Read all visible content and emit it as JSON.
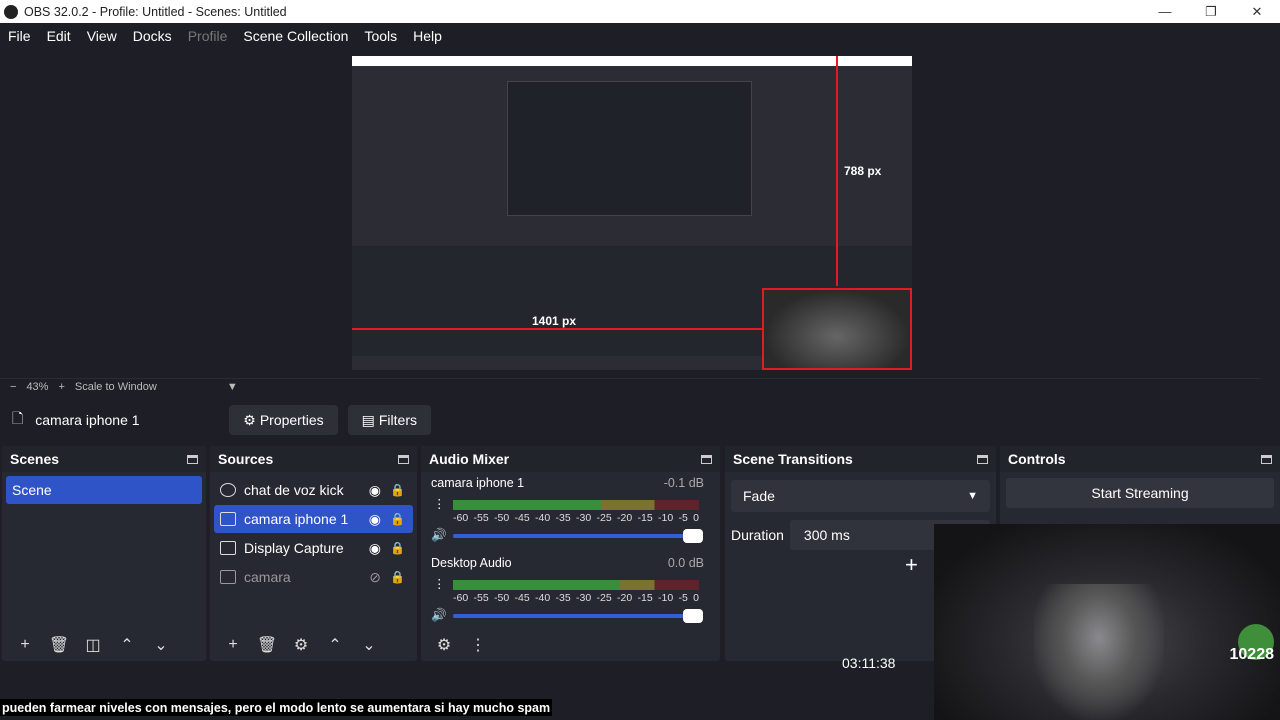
{
  "window": {
    "title": "OBS 32.0.2 - Profile: Untitled - Scenes: Untitled",
    "controls": [
      "—",
      "❐",
      "✕"
    ]
  },
  "menu": [
    "File",
    "Edit",
    "View",
    "Docks",
    "Profile",
    "Scene Collection",
    "Tools",
    "Help"
  ],
  "preview": {
    "label_width": "1401 px",
    "label_height": "788 px"
  },
  "zoombar": {
    "minus": "−",
    "zoom": "43%",
    "plus": "+",
    "scale": "Scale to Window"
  },
  "context": {
    "source": "camara iphone 1",
    "properties_label": "Properties",
    "filters_label": "Filters"
  },
  "scenes": {
    "title": "Scenes",
    "items": [
      "Scene"
    ]
  },
  "sources": {
    "title": "Sources",
    "items": [
      {
        "name": "chat de voz kick",
        "visible": true
      },
      {
        "name": "camara iphone 1",
        "visible": true
      },
      {
        "name": "Display Capture",
        "visible": true
      },
      {
        "name": "camara",
        "visible": false
      }
    ]
  },
  "mixer": {
    "title": "Audio Mixer",
    "ticks": [
      "-60",
      "-55",
      "-50",
      "-45",
      "-40",
      "-35",
      "-30",
      "-25",
      "-20",
      "-15",
      "-10",
      "-5",
      "0"
    ],
    "channels": [
      {
        "name": "camara iphone 1",
        "db": "-0.1 dB",
        "level": 0.6
      },
      {
        "name": "Desktop Audio",
        "db": "0.0 dB",
        "level": 0.68
      }
    ]
  },
  "transitions": {
    "title": "Scene Transitions",
    "selected": "Fade",
    "duration_label": "Duration",
    "duration_value": "300 ms"
  },
  "controls": {
    "title": "Controls",
    "start_streaming": "Start Streaming"
  },
  "status": {
    "time": "03:11:38"
  },
  "overlay": {
    "caption": "pueden farmear niveles con mensajes, pero el modo lento se aumentara si hay mucho spam",
    "badge": "10228"
  },
  "colors": {
    "accent": "#2f54c8",
    "selection_border": "#e01b24",
    "bg": "#1e1f26",
    "dock": "#272932"
  }
}
